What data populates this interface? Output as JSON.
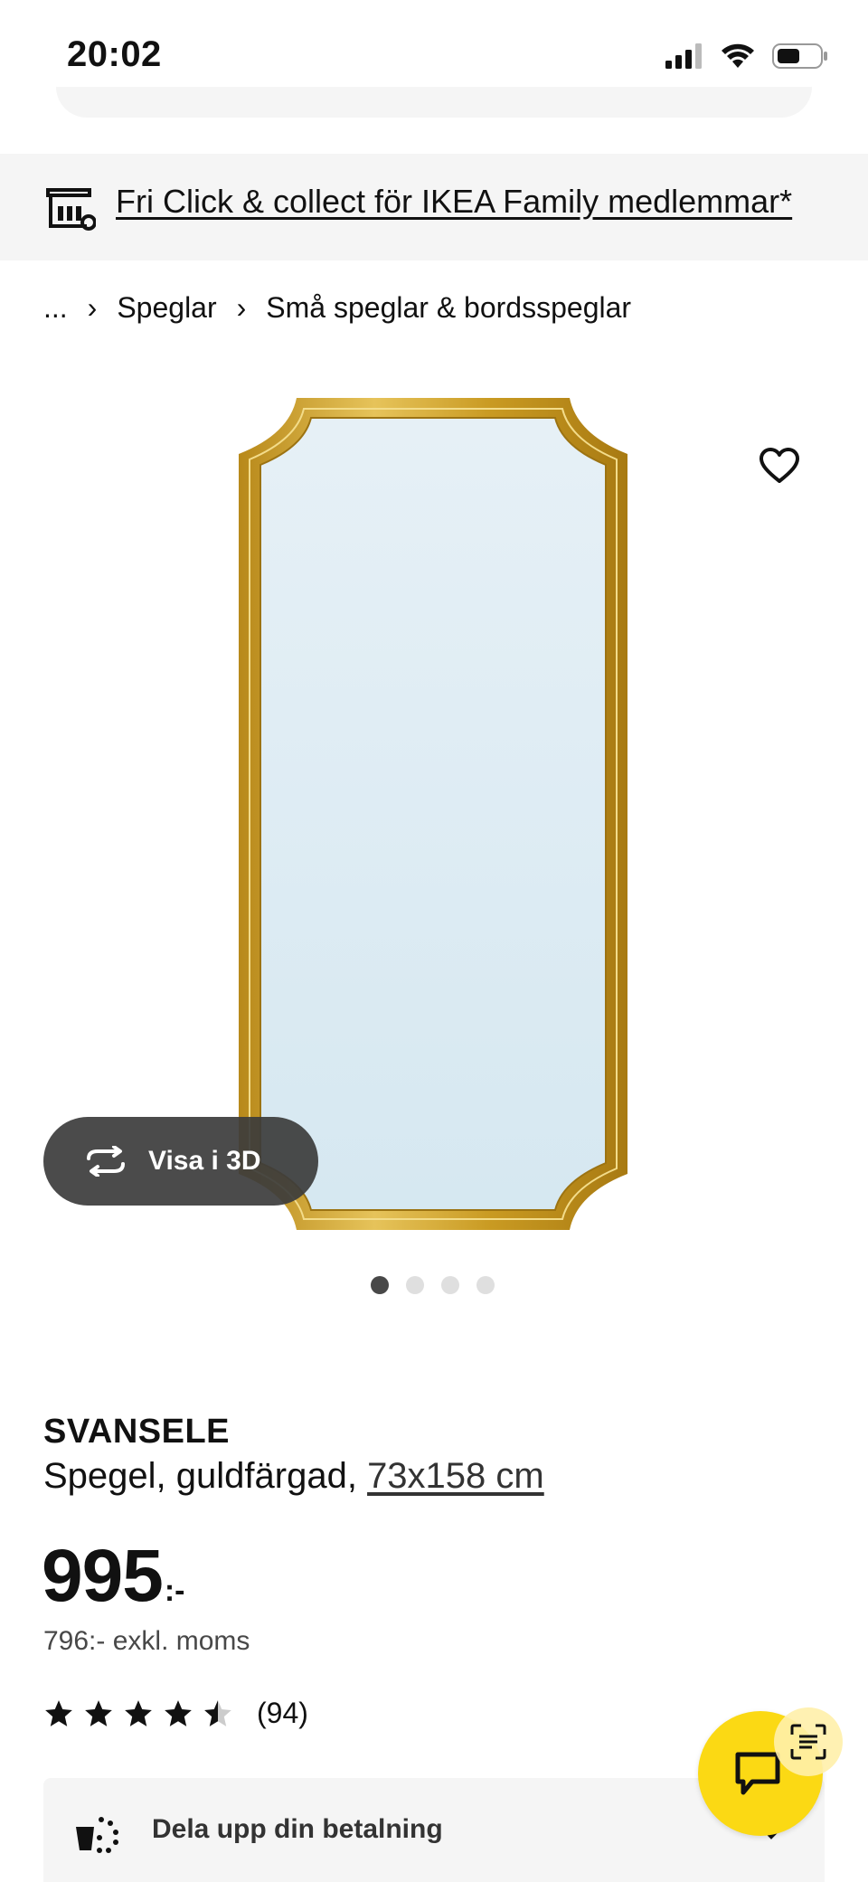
{
  "status_bar": {
    "time": "20:02",
    "icons": [
      "cellular-signal-icon",
      "wifi-icon",
      "battery-icon"
    ]
  },
  "promo": {
    "icon": "store-pickup-icon",
    "link_text": "Fri Click & collect för IKEA Family medlemmar*"
  },
  "breadcrumb": {
    "items": [
      "...",
      "Speglar",
      "Små speglar & bordsspeglar"
    ]
  },
  "gallery": {
    "image": "gold-framed-mirror",
    "view3d_label": "Visa i 3D",
    "slide_count": 4,
    "active_slide": 1
  },
  "product": {
    "name": "SVANSELE",
    "description": "Spegel, guldfärgad,",
    "size": "73x158 cm",
    "price": "995",
    "price_suffix": ":-",
    "price_ex_vat": "796:- exkl. moms",
    "rating": 4.5,
    "rating_max": 5,
    "review_count": "(94)"
  },
  "installment": {
    "icon": "split-payment-icon",
    "label": "Dela upp din betalning"
  },
  "colors": {
    "accent_yellow": "#fbd914",
    "banner_bg": "#f5f5f5",
    "frame_gold": "#c9a227",
    "mirror_glass": "#dcebf3"
  }
}
